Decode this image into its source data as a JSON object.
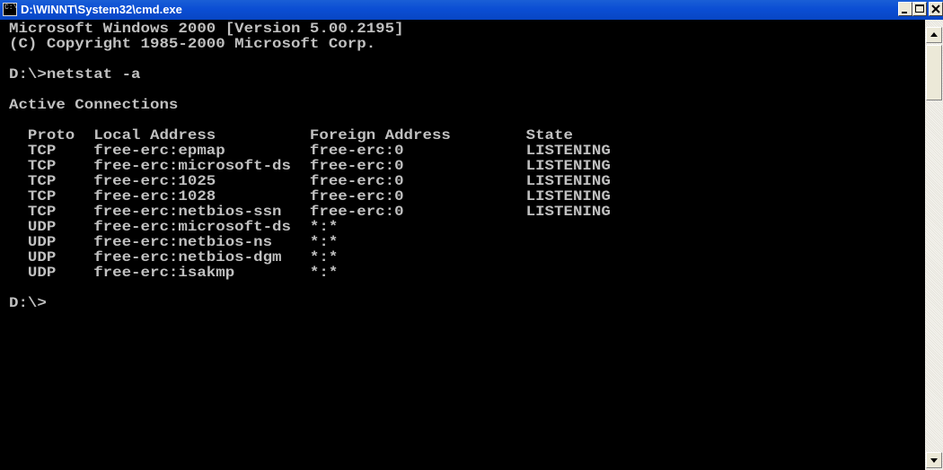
{
  "window": {
    "title": "D:\\WINNT\\System32\\cmd.exe",
    "icon_text": "C:\\"
  },
  "console": {
    "lines": [
      "Microsoft Windows 2000 [Version 5.00.2195]",
      "(C) Copyright 1985-2000 Microsoft Corp.",
      "",
      "D:\\>netstat -a",
      "",
      "Active Connections",
      "",
      "  Proto  Local Address          Foreign Address        State",
      "  TCP    free-erc:epmap         free-erc:0             LISTENING",
      "  TCP    free-erc:microsoft-ds  free-erc:0             LISTENING",
      "  TCP    free-erc:1025          free-erc:0             LISTENING",
      "  TCP    free-erc:1028          free-erc:0             LISTENING",
      "  TCP    free-erc:netbios-ssn   free-erc:0             LISTENING",
      "  UDP    free-erc:microsoft-ds  *:*",
      "  UDP    free-erc:netbios-ns    *:*",
      "  UDP    free-erc:netbios-dgm   *:*",
      "  UDP    free-erc:isakmp        *:*",
      "",
      "D:\\>"
    ]
  },
  "icons": {
    "app": "cmd-icon",
    "minimize": "minimize-icon",
    "maximize": "maximize-icon",
    "close": "close-icon",
    "scroll_up": "arrow-up-icon",
    "scroll_down": "arrow-down-icon"
  }
}
